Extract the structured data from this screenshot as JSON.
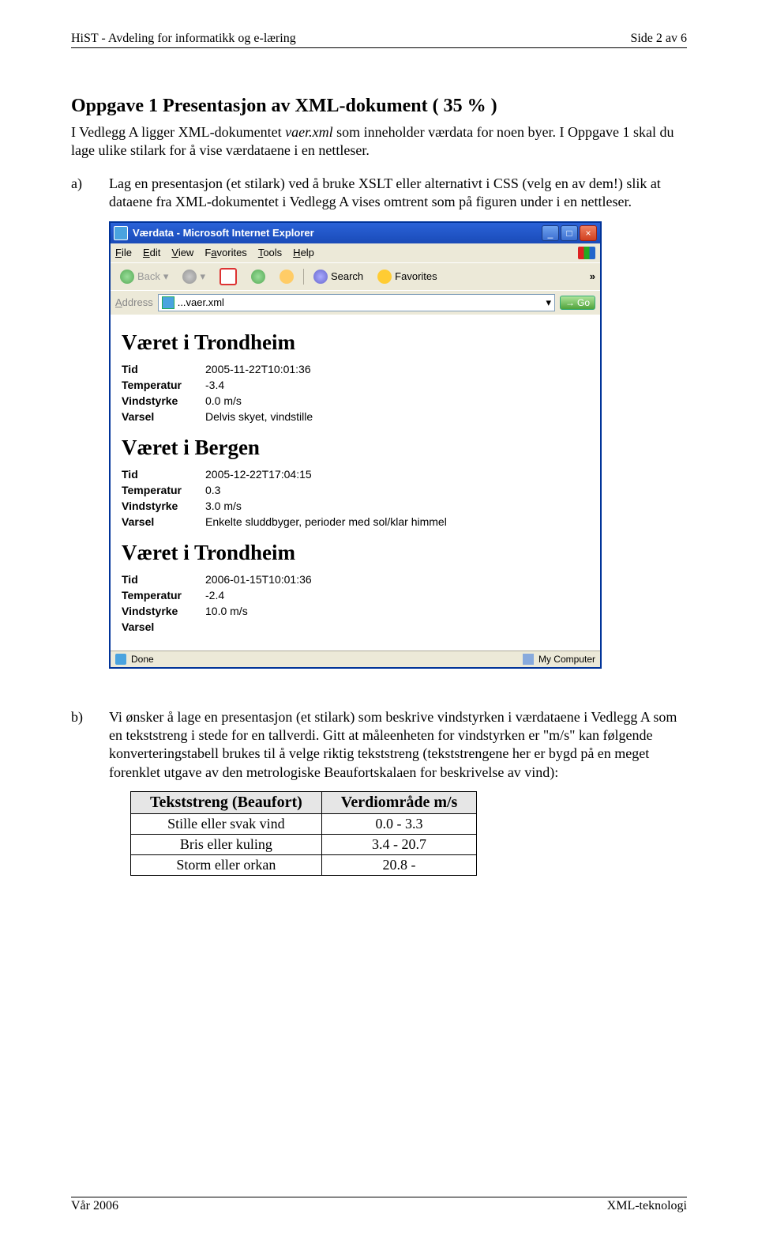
{
  "header": {
    "left": "HiST - Avdeling for informatikk og e-læring",
    "right": "Side 2 av 6"
  },
  "footer": {
    "left": "Vår 2006",
    "right": "XML-teknologi"
  },
  "title_line": "Oppgave 1 Presentasjon av XML-dokument ( 35 % )",
  "intro": {
    "pre": "I Vedlegg A ligger XML-dokumentet ",
    "file": "vaer.xml",
    "post": " som inneholder værdata for noen byer. I Oppgave 1 skal du lage ulike stilark for å vise værdataene i en nettleser."
  },
  "item_a": {
    "marker": "a)",
    "text": "Lag en presentasjon (et stilark) ved å bruke XSLT eller alternativt i CSS (velg en av dem!) slik at dataene fra XML-dokumentet i Vedlegg A vises omtrent som på figuren under i en nettleser."
  },
  "browser": {
    "title": "Værdata - Microsoft Internet Explorer",
    "menu": {
      "file": "File",
      "edit": "Edit",
      "view": "View",
      "fav": "Favorites",
      "tools": "Tools",
      "help": "Help"
    },
    "tb": {
      "back": "Back",
      "search": "Search",
      "favorites": "Favorites"
    },
    "address_label": "Address",
    "address_value": "...vaer.xml",
    "go": "Go",
    "status_done": "Done",
    "status_zone": "My Computer",
    "labels": {
      "tid": "Tid",
      "temp": "Temperatur",
      "vind": "Vindstyrke",
      "varsel": "Varsel"
    },
    "sections": [
      {
        "heading": "Været i Trondheim",
        "tid": "2005-11-22T10:01:36",
        "temp": "-3.4",
        "vind": "0.0 m/s",
        "varsel": "Delvis skyet, vindstille"
      },
      {
        "heading": "Været i Bergen",
        "tid": "2005-12-22T17:04:15",
        "temp": "0.3",
        "vind": "3.0 m/s",
        "varsel": "Enkelte sluddbyger, perioder med sol/klar himmel"
      },
      {
        "heading": "Været i Trondheim",
        "tid": "2006-01-15T10:01:36",
        "temp": "-2.4",
        "vind": "10.0 m/s",
        "varsel": ""
      }
    ]
  },
  "item_b": {
    "marker": "b)",
    "text": "Vi ønsker å lage en presentasjon (et stilark) som beskrive vindstyrken i værdataene i Vedlegg A som en tekststreng i stede for en tallverdi. Gitt at måleenheten for vindstyrken er \"m/s\" kan følgende konverteringstabell brukes til å velge riktig tekststreng (tekststrengene her er bygd på en meget forenklet utgave av den metrologiske Beaufortskalaen for beskrivelse av vind):"
  },
  "table": {
    "head": [
      "Tekststreng (Beaufort)",
      "Verdiområde m/s"
    ],
    "rows": [
      [
        "Stille eller svak vind",
        "0.0 - 3.3"
      ],
      [
        "Bris eller kuling",
        "3.4 - 20.7"
      ],
      [
        "Storm eller orkan",
        "20.8 -"
      ]
    ]
  }
}
